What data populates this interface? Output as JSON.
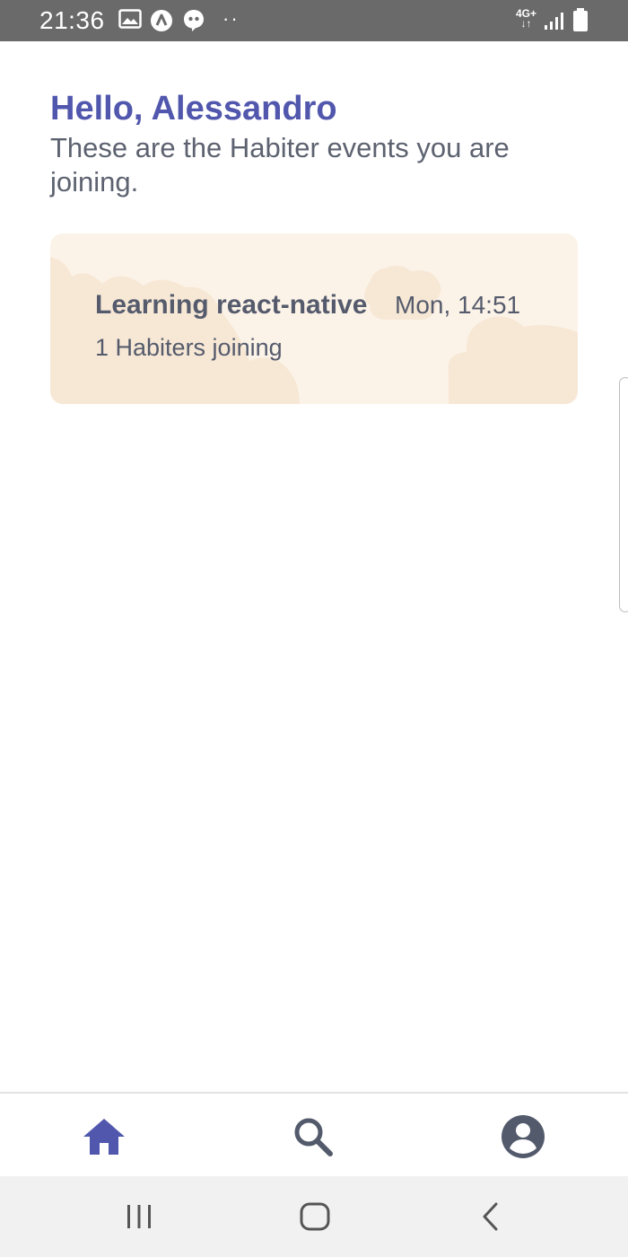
{
  "status_bar": {
    "time": "21:36",
    "network": "4G+",
    "icons": [
      "gallery-icon",
      "a-app-icon",
      "chat-bubble-icon",
      "more-dots-icon",
      "network-4g-icon",
      "signal-icon",
      "battery-icon"
    ],
    "dots": "··"
  },
  "header": {
    "greeting": "Hello, Alessandro",
    "subtitle": "These are the Habiter events you are joining."
  },
  "events": [
    {
      "title": "Learning react-native",
      "time": "Mon, 14:51",
      "joining": "1 Habiters joining"
    }
  ],
  "tab_bar": {
    "tabs": [
      {
        "icon": "home-icon",
        "active": true
      },
      {
        "icon": "search-icon",
        "active": false
      },
      {
        "icon": "profile-icon",
        "active": false
      }
    ]
  },
  "nav_bar": {
    "buttons": [
      "recents-icon",
      "home-button-icon",
      "back-icon"
    ]
  },
  "colors": {
    "accent": "#5157ad",
    "text": "#555b6c",
    "card_background": "#fcf3e8",
    "cloud": "#f7e8d6",
    "inactive_icon": "#535a6b",
    "status_bar": "#6a6a6a",
    "nav_bar": "#f1f1f1"
  }
}
